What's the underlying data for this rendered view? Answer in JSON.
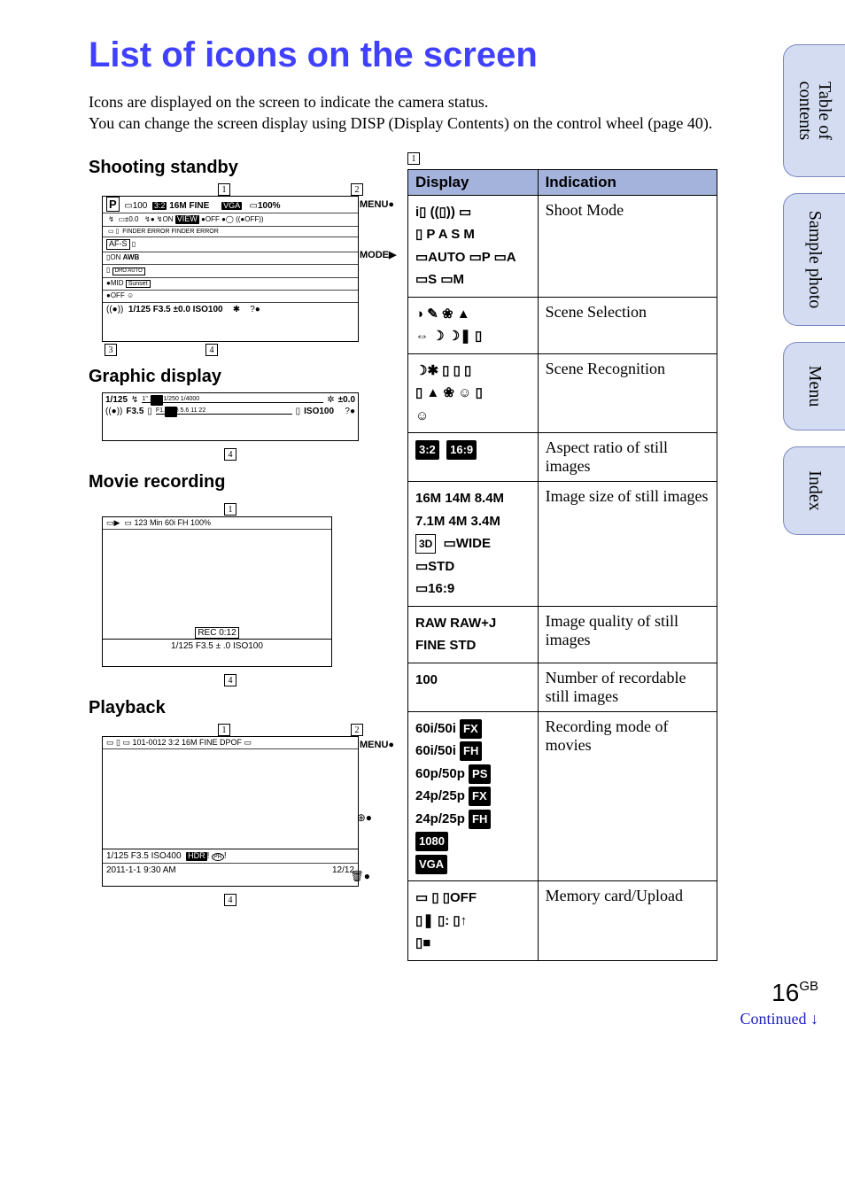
{
  "title": "List of icons on the screen",
  "intro": "Icons are displayed on the screen to indicate the camera status.\nYou can change the screen display using DISP (Display Contents) on the control wheel (page 40).",
  "sections": {
    "shooting": "Shooting standby",
    "graphic": "Graphic display",
    "movie": "Movie recording",
    "playback": "Playback"
  },
  "fig_std": {
    "menu": "MENU",
    "mode": "MODE",
    "line1_a": "P",
    "line1_b": "100",
    "line1_c": "3:2",
    "line1_d": "16M",
    "line1_e": "FINE",
    "line1_f": "VGA",
    "line1_g": "100%",
    "line2": "FINDER ERROR   FINDER   ERROR",
    "line_awb": "AWB",
    "bottom": "1/125    F3.5   ±0.0    ISO100"
  },
  "fig_gd": {
    "l1a": "1/125",
    "l1b": "1\"  1/30   1/250   1/4000",
    "l1c": "±0.0",
    "l2a": "F3.5",
    "l2b": "F1.4  2.8   5.6    11    22",
    "l2c": "ISO100"
  },
  "fig_mv": {
    "top": "123 Min        60i FH        100%",
    "rec": "REC 0:12",
    "bottom": "1/125     F3.5   ± .0     ISO100"
  },
  "fig_pb": {
    "menu": "MENU",
    "top": "101-0012  3:2 16M FINE   DPOF",
    "l1": "1/125   F3.5   ISO400",
    "l2a": "2011-1-1   9:30 AM",
    "l2b": "12/12"
  },
  "table_section": "1",
  "table": {
    "head_display": "Display",
    "head_indication": "Indication",
    "rows": [
      {
        "display": "i▯ ((▯)) ▭\n▯  P A S M\n▭AUTO  ▭P  ▭A\n▭S  ▭M",
        "indication": "Shoot Mode"
      },
      {
        "display": "◑ ✎ ❀ ▲\n⇔ ☽ ☽❚ ▯",
        "indication": "Scene Selection"
      },
      {
        "display": "☽✱ ▯ ▯ ▯\n▯ ▲ ❀ ☺ ▯\n☺",
        "indication": "Scene Recognition"
      },
      {
        "display": "<span class='chip'>3:2</span>&nbsp;&nbsp;<span class='chip'>16:9</span>",
        "indication": "Aspect ratio of still images"
      },
      {
        "display": "16M 14M 8.4M<br>7.1M 4M 3.4M<br><span class='chipw'>3D</span>&nbsp;&nbsp;▭WIDE<br>▭STD<br>▭16:9",
        "indication": "Image size of still images"
      },
      {
        "display": "RAW RAW+J<br>FINE STD",
        "indication": "Image quality of still images"
      },
      {
        "display": "100",
        "indication": "Number of recordable still images"
      },
      {
        "display": "60i/50i <span class='chip'>FX</span><br>60i/50i <span class='chip'>FH</span><br>60p/50p <span class='chip'>PS</span><br>24p/25p <span class='chip'>FX</span><br>24p/25p <span class='chip'>FH</span><br><span class='chip'>1080</span><br><span class='chip'>VGA</span>",
        "indication": "Recording mode of movies"
      },
      {
        "display": "▭ ▯ ▯OFF<br>▯❚ ▯: ▯↑<br>▯■",
        "indication": "Memory card/Upload"
      }
    ]
  },
  "tabs": {
    "toc": "Table of\ncontents",
    "sample": "Sample photo",
    "menu": "Menu",
    "index": "Index"
  },
  "pagenum": "16",
  "pagelang": "GB",
  "continued": "Continued",
  "arrow": "↓"
}
